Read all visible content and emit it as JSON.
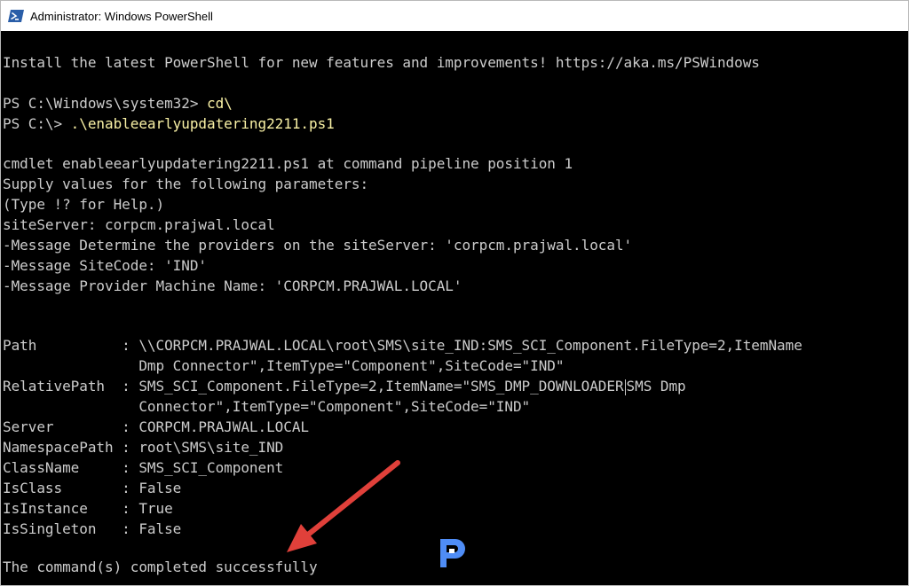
{
  "window": {
    "title": "Administrator: Windows PowerShell"
  },
  "console": {
    "banner": "Install the latest PowerShell for new features and improvements! https://aka.ms/PSWindows",
    "prompt1": "PS C:\\Windows\\system32> ",
    "cmd1": "cd\\",
    "prompt2": "PS C:\\> ",
    "cmd2": ".\\enableearlyupdatering2211.ps1",
    "out1": "cmdlet enableearlyupdatering2211.ps1 at command pipeline position 1",
    "out2": "Supply values for the following parameters:",
    "out3": "(Type !? for Help.)",
    "out4": "siteServer: corpcm.prajwal.local",
    "out5": "-Message Determine the providers on the siteServer: 'corpcm.prajwal.local'",
    "out6": "-Message SiteCode: 'IND'",
    "out7": "-Message Provider Machine Name: 'CORPCM.PRAJWAL.LOCAL'",
    "path_line1": "Path          : \\\\CORPCM.PRAJWAL.LOCAL\\root\\SMS\\site_IND:SMS_SCI_Component.FileType=2,ItemName",
    "path_line2": "                Dmp Connector\",ItemType=\"Component\",SiteCode=\"IND\"",
    "relpath_line1": "RelativePath  : SMS_SCI_Component.FileType=2,ItemName=\"SMS_DMP_DOWNLOADER",
    "relpath_line1b": "SMS Dmp",
    "relpath_line2": "                Connector\",ItemType=\"Component\",SiteCode=\"IND\"",
    "server": "Server        : CORPCM.PRAJWAL.LOCAL",
    "namespace": "NamespacePath : root\\SMS\\site_IND",
    "classname": "ClassName     : SMS_SCI_Component",
    "isclass": "IsClass       : False",
    "isinstance": "IsInstance    : True",
    "issingleton": "IsSingleton   : False",
    "final": "The command(s) completed successfully"
  },
  "colors": {
    "background": "#000000",
    "text": "#cccccc",
    "command": "#f9f1a5",
    "arrow": "#e0403a",
    "logo": "#4f8df6"
  },
  "icons": [
    "powershell-icon",
    "annotation-arrow-icon",
    "site-logo-icon"
  ]
}
